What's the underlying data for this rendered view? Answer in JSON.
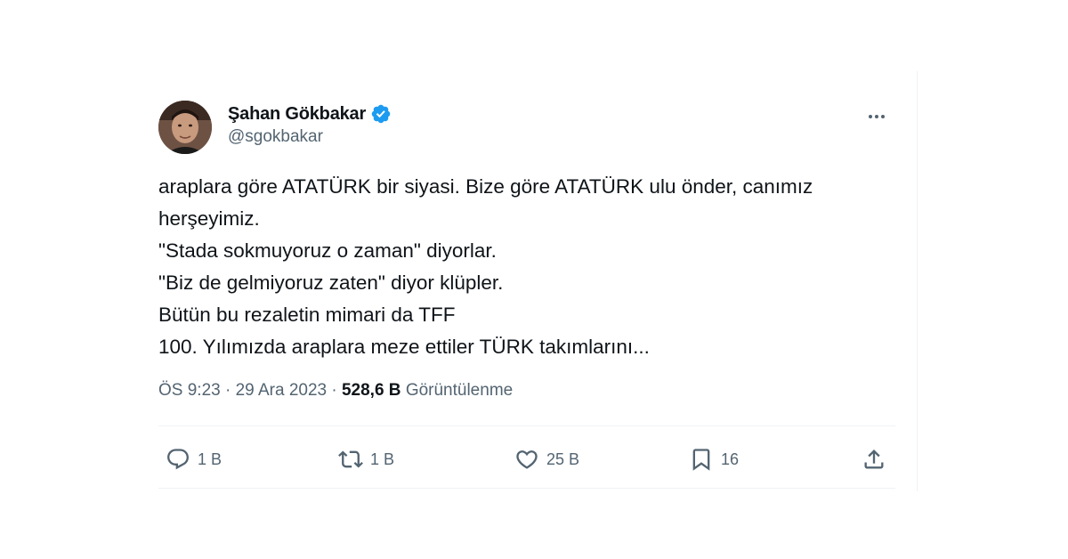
{
  "author": {
    "display_name": "Şahan Gökbakar",
    "handle": "@sgokbakar",
    "verified": true
  },
  "tweet": {
    "lines": [
      "araplara göre ATATÜRK bir siyasi. Bize göre ATATÜRK ulu önder, canımız",
      "herşeyimiz.",
      "\"Stada sokmuyoruz o zaman\" diyorlar.",
      "\"Biz de gelmiyoruz zaten\" diyor klüpler.",
      "Bütün bu rezaletin mimari da TFF",
      "100. Yılımızda araplara meze ettiler TÜRK takımlarını..."
    ]
  },
  "meta": {
    "time": "ÖS 9:23",
    "separator": "·",
    "date": "29 Ara 2023",
    "views_count": "528,6 B",
    "views_label": "Görüntülenme"
  },
  "actions": {
    "reply_count": "1 B",
    "retweet_count": "1 B",
    "like_count": "25 B",
    "bookmark_count": "16"
  },
  "colors": {
    "verified": "#1d9bf0",
    "text_primary": "#0f1419",
    "text_secondary": "#536471",
    "divider": "#eff3f4"
  },
  "icons": {
    "reply": "reply-icon",
    "retweet": "retweet-icon",
    "like": "heart-icon",
    "bookmark": "bookmark-icon",
    "share": "share-icon",
    "more": "more-icon",
    "verified": "verified-badge-icon"
  }
}
